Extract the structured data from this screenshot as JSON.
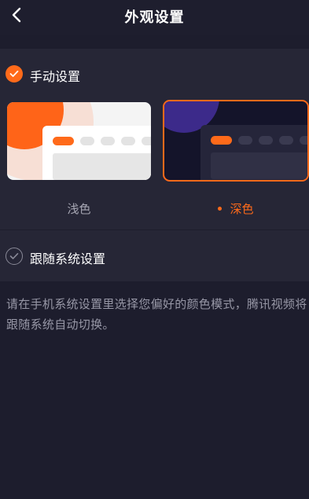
{
  "header": {
    "title": "外观设置",
    "back_icon": "chevron-left-icon"
  },
  "options": {
    "manual": {
      "label": "手动设置",
      "checked": true
    },
    "system": {
      "label": "跟随系统设置",
      "checked": false
    }
  },
  "themes": {
    "light": {
      "label": "浅色",
      "selected": false
    },
    "dark": {
      "label": "深色",
      "selected": true
    }
  },
  "description": "请在手机系统设置里选择您偏好的颜色模式，腾讯视频将跟随系统自动切换。",
  "colors": {
    "accent": "#ff6a1a",
    "background": "#1d1d2d",
    "panel": "#262636"
  }
}
